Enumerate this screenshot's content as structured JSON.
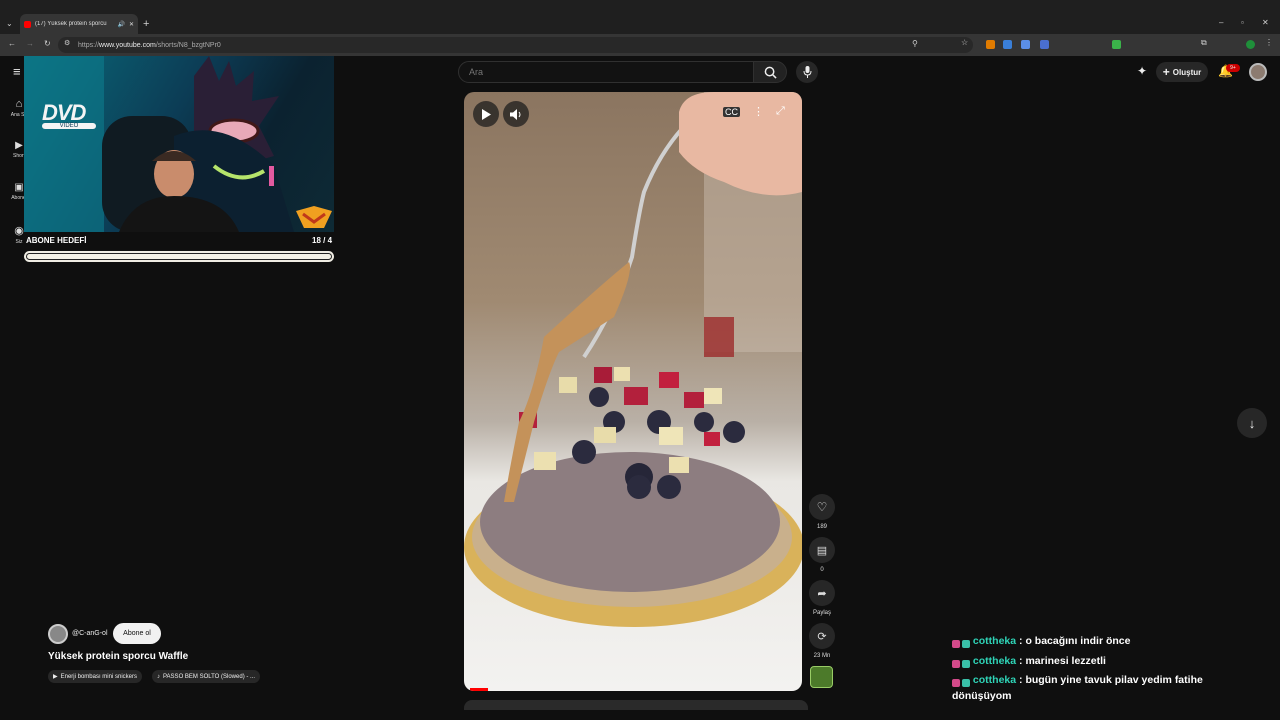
{
  "browser": {
    "tab_title": "(17) Yüksek protein sporcu",
    "url_prefix": "https://",
    "url_domain": "www.youtube.com",
    "url_path": "/shorts/N8_bzgtNPr0"
  },
  "youtube": {
    "search_placeholder": "Ara",
    "create_label": "Oluştur",
    "notification_count": "9+",
    "sidebar": [
      {
        "label": "Ana Sa"
      },
      {
        "label": "Short"
      },
      {
        "label": "Abonel"
      },
      {
        "label": "Siz"
      }
    ]
  },
  "stream_overlay": {
    "dvd_logo": "DVD",
    "dvd_sub": "VIDEO",
    "goal_label": "ABONE HEDEFİ",
    "goal_count": "18 / 4",
    "goal_fraction": 1.0
  },
  "short": {
    "likes": "189",
    "comments": "0",
    "share_label": "Paylaş",
    "remix_count": "23 Mn",
    "channel": "@C-anG-ol",
    "subscribe_label": "Abone ol",
    "title": "Yüksek protein sporcu Waffle",
    "chips": [
      "Enerji bombası mini snickers",
      "PASSO BEM SOLTO (Slowed) - ..."
    ]
  },
  "chat": [
    {
      "user": "cottheka",
      "message": ": o bacağını indir önce"
    },
    {
      "user": "cottheka",
      "message": ": marinesi lezzetli"
    },
    {
      "user": "cottheka",
      "message": ": bugün yine tavuk pilav yedim fatihe dönüşüyom"
    }
  ],
  "colors": {
    "accent": "#ff0000",
    "chat_user": "#2fd5b8",
    "background": "#0f0f0f"
  }
}
